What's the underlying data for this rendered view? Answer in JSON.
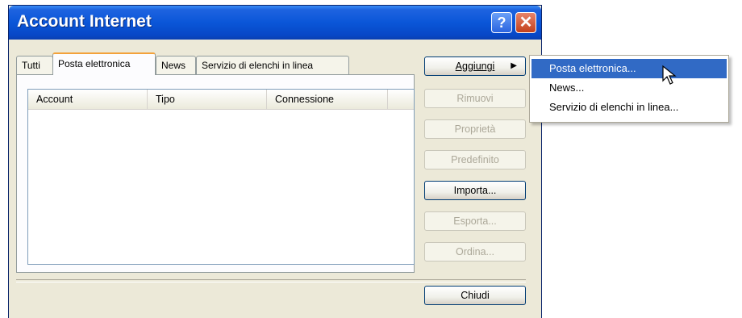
{
  "window": {
    "title": "Account Internet"
  },
  "title_buttons": {
    "help": "?",
    "close": "✕"
  },
  "tabs": [
    {
      "label": "Tutti"
    },
    {
      "label": "Posta elettronica"
    },
    {
      "label": "News"
    },
    {
      "label": "Servizio di elenchi in linea"
    }
  ],
  "list": {
    "columns": [
      "Account",
      "Tipo",
      "Connessione"
    ],
    "rows": []
  },
  "buttons": {
    "aggiungi": "Aggiungi",
    "rimuovi": "Rimuovi",
    "proprieta": "Proprietà",
    "predefinito": "Predefinito",
    "importa": "Importa...",
    "esporta": "Esporta...",
    "ordina": "Ordina...",
    "chiudi": "Chiudi"
  },
  "menu": {
    "items": [
      {
        "label": "Posta elettronica..."
      },
      {
        "label": "News..."
      },
      {
        "label": "Servizio di elenchi in linea..."
      }
    ]
  },
  "colors": {
    "titlebar": "#0a56d8",
    "menu_highlight": "#316ac5",
    "active_tab_accent": "#f3a23b"
  }
}
